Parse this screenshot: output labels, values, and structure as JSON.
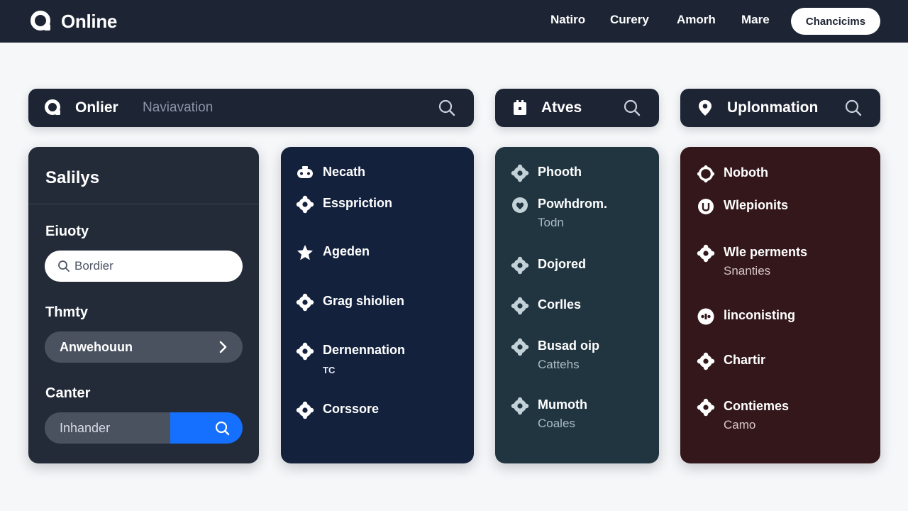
{
  "app": {
    "brand": "Online",
    "nav": [
      "Natiro",
      "Curery",
      "Amorh",
      "Mare"
    ],
    "cta": "Chancicims"
  },
  "search_bars": [
    {
      "title": "Onlier",
      "placeholder": "Naviavation",
      "lead_icon": "logo-icon"
    },
    {
      "title": "Atves",
      "placeholder": "",
      "lead_icon": "calendar-icon"
    },
    {
      "title": "Uplonmation",
      "placeholder": "",
      "lead_icon": "location-pin-icon"
    }
  ],
  "sidebar": {
    "title": "Salilys",
    "sections": [
      {
        "label": "Eiuoty",
        "field_placeholder": "Bordier"
      },
      {
        "label": "Thmty",
        "field_value": "Anwehouun"
      },
      {
        "label": "Canter",
        "field_value": "Inhander"
      }
    ]
  },
  "panel_navy": {
    "items": [
      {
        "label": "Necath",
        "sub": "",
        "icon": "gamepad-icon"
      },
      {
        "label": "Esspriction",
        "sub": "",
        "icon": "gear-icon"
      },
      {
        "label": "Ageden",
        "sub": "",
        "icon": "star-icon"
      },
      {
        "label": "Grag shiolien",
        "sub": "",
        "icon": "gear-icon"
      },
      {
        "label": "Dernennation",
        "sub": "TC",
        "icon": "gear-icon"
      },
      {
        "label": "Corssore",
        "sub": "",
        "icon": "gear-icon"
      }
    ]
  },
  "panel_teal": {
    "items": [
      {
        "label": "Phooth",
        "sub": "",
        "icon": "gear-icon"
      },
      {
        "label": "Powhdrom.",
        "sub": "Todn",
        "icon": "heart-icon"
      },
      {
        "label": "Dojored",
        "sub": "",
        "icon": "gear-icon"
      },
      {
        "label": "Corlles",
        "sub": "",
        "icon": "gear-icon"
      },
      {
        "label": "Busad oip",
        "sub": "Cattehs",
        "icon": "gear-icon"
      },
      {
        "label": "Mumoth",
        "sub": "Coales",
        "icon": "gear-icon"
      }
    ]
  },
  "panel_maroon": {
    "items": [
      {
        "label": "Noboth",
        "sub": "",
        "icon": "gear-icon"
      },
      {
        "label": "Wlepionits",
        "sub": "",
        "icon": "shield-icon"
      },
      {
        "label": "Wle perments",
        "sub": "Snanties",
        "icon": "gear-icon"
      },
      {
        "label": "linconisting",
        "sub": "",
        "icon": "gamepad-icon"
      },
      {
        "label": "Chartir",
        "sub": "",
        "icon": "gear-icon"
      },
      {
        "label": "Contiemes",
        "sub": "Camo",
        "icon": "gear-icon"
      }
    ]
  },
  "colors": {
    "topbar": "#1d2433",
    "accent_blue": "#1570ff",
    "panel_navy": "#13213d",
    "panel_teal": "#213541",
    "panel_maroon": "#33171a",
    "panel_slate": "#232b38"
  }
}
